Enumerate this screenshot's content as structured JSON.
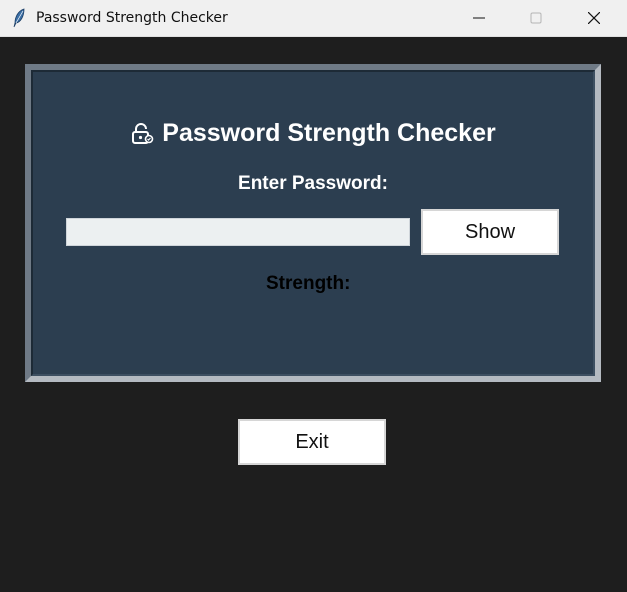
{
  "window": {
    "title": "Password Strength Checker",
    "controls": {
      "minimize_icon": "minimize-icon",
      "maximize_icon": "maximize-icon",
      "close_icon": "close-icon"
    },
    "app_icon": "feather-icon"
  },
  "panel": {
    "heading": "Password Strength Checker",
    "heading_icon": "lock-icon",
    "enter_label": "Enter Password:",
    "password_value": "",
    "show_label": "Show",
    "strength_label": "Strength:"
  },
  "footer": {
    "exit_label": "Exit"
  },
  "colors": {
    "background": "#1e1e1e",
    "panel": "#2c3e50",
    "input": "#ecf0f1",
    "heading_text": "#ffffff",
    "strength_text": "#000000"
  }
}
